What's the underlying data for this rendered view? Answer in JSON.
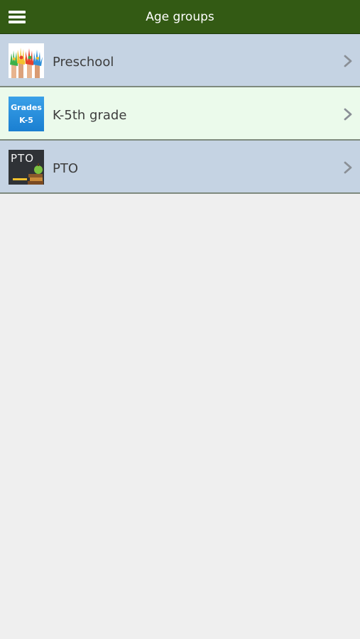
{
  "header": {
    "title": "Age groups",
    "menu_icon": "menu-icon"
  },
  "items": [
    {
      "label": "Preschool",
      "icon": "painted-hands-icon",
      "row_color": "#c5d3e3"
    },
    {
      "label": "K-5th grade",
      "icon": "grades-k5-icon",
      "thumb_line1": "Grades",
      "thumb_line2": "K-5",
      "row_color": "#ebfaeb"
    },
    {
      "label": "PTO",
      "icon": "pto-chalkboard-icon",
      "thumb_text": "PTO",
      "row_color": "#c5d3e3"
    }
  ],
  "colors": {
    "header_bg": "#335a14",
    "page_bg": "#efefef",
    "text": "#3d3d3d",
    "divider": "#7e8a7e"
  }
}
